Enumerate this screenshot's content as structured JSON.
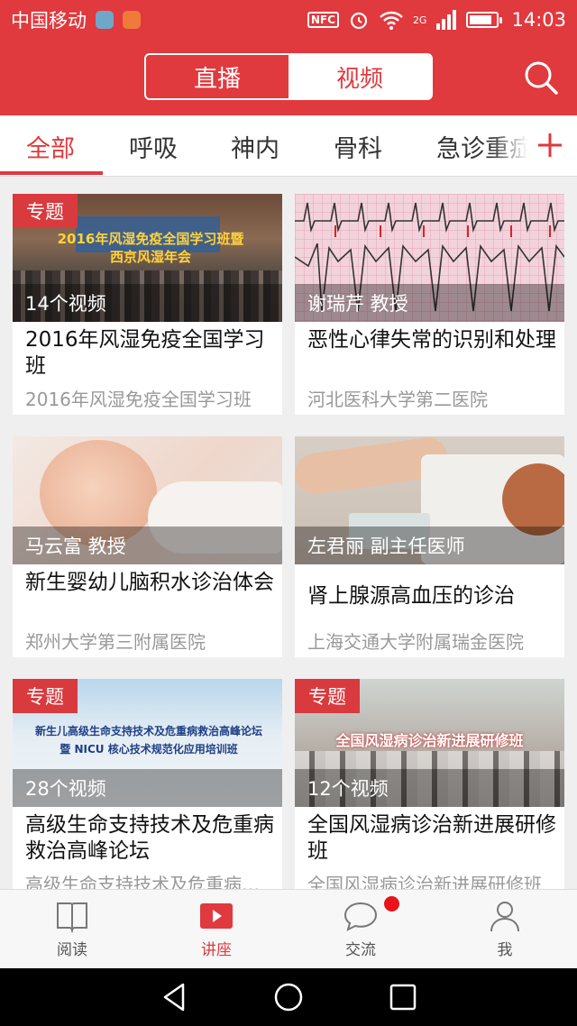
{
  "status_bar": {
    "carrier": "中国移动",
    "time": "14:03",
    "nfc": "NFC",
    "network": "2G",
    "battery_level": 0.85
  },
  "header": {
    "tabs": [
      {
        "label": "直播",
        "active": false
      },
      {
        "label": "视频",
        "active": true
      }
    ],
    "search_icon": "search-icon"
  },
  "categories": [
    {
      "label": "全部",
      "active": true
    },
    {
      "label": "呼吸",
      "active": false
    },
    {
      "label": "神内",
      "active": false
    },
    {
      "label": "骨科",
      "active": false
    },
    {
      "label": "急诊重症",
      "active": false
    }
  ],
  "add_icon": "plus-icon",
  "cards": [
    {
      "tag": "专题",
      "overlay": "14个视频",
      "title": "2016年风湿免疫全国学习班",
      "subtitle": "2016年风湿免疫全国学习班",
      "image_text": "2016年风湿免疫全国学习班暨\n西京风湿年会"
    },
    {
      "tag": "",
      "overlay": "谢瑞芹 教授",
      "title": "恶性心律失常的识别和处理",
      "subtitle": "河北医科大学第二医院",
      "image_text": ""
    },
    {
      "tag": "",
      "overlay": "马云富 教授",
      "title": "新生婴幼儿脑积水诊治体会",
      "subtitle": "郑州大学第三附属医院",
      "image_text": ""
    },
    {
      "tag": "",
      "overlay": "左君丽 副主任医师",
      "title": "肾上腺源高血压的诊治",
      "subtitle": "上海交通大学附属瑞金医院",
      "image_text": ""
    },
    {
      "tag": "专题",
      "overlay": "28个视频",
      "title": "高级生命支持技术及危重病救治高峰论坛",
      "subtitle": "高级生命支持技术及危重病救治高峰论坛",
      "image_text": "新生儿高级生命支持技术及危重病救治高峰论坛\n暨 NICU 核心技术规范化应用培训班"
    },
    {
      "tag": "专题",
      "overlay": "12个视频",
      "title": "全国风湿病诊治新进展研修班",
      "subtitle": "全国风湿病诊治新进展研修班",
      "image_text": "全国风湿病诊治新进展研修班"
    }
  ],
  "bottom_nav": [
    {
      "label": "阅读",
      "icon": "book-icon",
      "active": false
    },
    {
      "label": "讲座",
      "icon": "play-icon",
      "active": true
    },
    {
      "label": "交流",
      "icon": "chat-icon",
      "active": false,
      "badge": true
    },
    {
      "label": "我",
      "icon": "person-icon",
      "active": false
    }
  ],
  "colors": {
    "brand": "#e0393e",
    "tag": "#d83a3e",
    "badge": "#e8141b"
  }
}
